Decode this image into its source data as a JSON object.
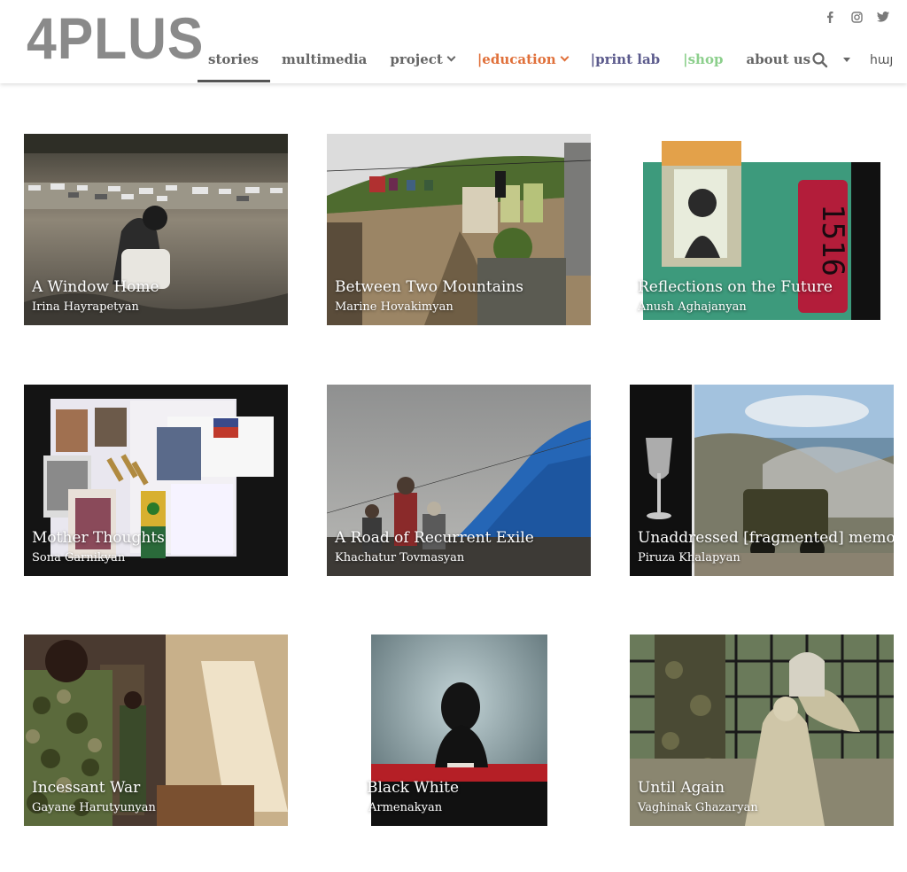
{
  "site": {
    "logo": "4PLUS"
  },
  "social": [
    {
      "icon": "facebook-icon"
    },
    {
      "icon": "instagram-icon"
    },
    {
      "icon": "twitter-icon"
    }
  ],
  "nav": {
    "items": [
      {
        "label": "stories",
        "color": "#666666"
      },
      {
        "label": "multimedia",
        "color": "#666666"
      },
      {
        "label": "project",
        "color": "#666666"
      },
      {
        "label": "|education",
        "color": "#e0703a"
      },
      {
        "label": "|print lab",
        "color": "#5b5a8c"
      },
      {
        "label": "|shop",
        "color": "#8ccf8c"
      },
      {
        "label": "about us",
        "color": "#666666"
      }
    ],
    "lang_label": "հայ"
  },
  "stories": [
    {
      "title": "A Window Home",
      "author": "Irina Hayrapetyan"
    },
    {
      "title": "Between Two Mountains",
      "author": "Marine Hovakimyan"
    },
    {
      "title": "Reflections on the Future",
      "author": "Anush Aghajanyan"
    },
    {
      "title": "Mother Thoughts",
      "author": "Sona Garnikyan"
    },
    {
      "title": "A Road of Recurrent Exile",
      "author": "Khachatur Tovmasyan"
    },
    {
      "title": "Unaddressed [fragmented] memory",
      "author": "Piruza Khalapyan"
    },
    {
      "title": "Incessant War",
      "author": "Gayane Harutyunyan"
    },
    {
      "title": "Black White",
      "author": "Armenakyan"
    },
    {
      "title": "Until Again",
      "author": "Vaghinak Ghazaryan"
    }
  ],
  "colors": {
    "logo": "#8a8a8a",
    "nav_text": "#666666",
    "education": "#e0703a",
    "print_lab": "#5b5a8c",
    "shop": "#8ccf8c"
  }
}
